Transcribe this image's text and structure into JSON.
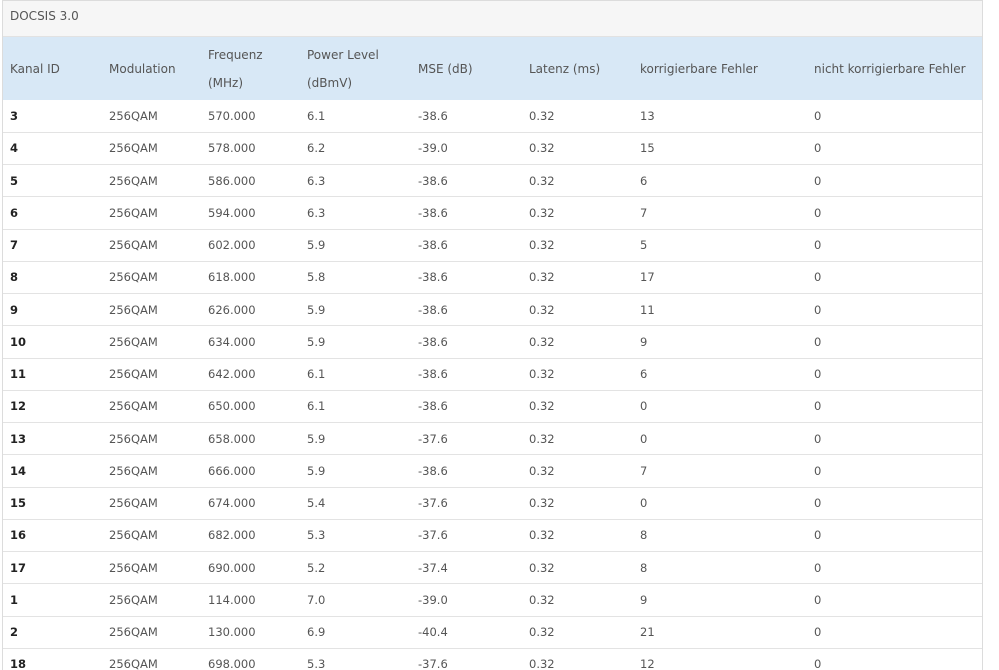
{
  "panel": {
    "title": "DOCSIS 3.0"
  },
  "table": {
    "headers": [
      [
        "Kanal ID"
      ],
      [
        "Modulation"
      ],
      [
        "Frequenz (MHz)"
      ],
      [
        "Power Level",
        "(dBmV)"
      ],
      [
        "MSE (dB)"
      ],
      [
        "Latenz (ms)"
      ],
      [
        "korrigierbare Fehler"
      ],
      [
        "nicht korrigierbare Fehler"
      ]
    ],
    "rows": [
      [
        "3",
        "256QAM",
        "570.000",
        "6.1",
        "-38.6",
        "0.32",
        "13",
        "0"
      ],
      [
        "4",
        "256QAM",
        "578.000",
        "6.2",
        "-39.0",
        "0.32",
        "15",
        "0"
      ],
      [
        "5",
        "256QAM",
        "586.000",
        "6.3",
        "-38.6",
        "0.32",
        "6",
        "0"
      ],
      [
        "6",
        "256QAM",
        "594.000",
        "6.3",
        "-38.6",
        "0.32",
        "7",
        "0"
      ],
      [
        "7",
        "256QAM",
        "602.000",
        "5.9",
        "-38.6",
        "0.32",
        "5",
        "0"
      ],
      [
        "8",
        "256QAM",
        "618.000",
        "5.8",
        "-38.6",
        "0.32",
        "17",
        "0"
      ],
      [
        "9",
        "256QAM",
        "626.000",
        "5.9",
        "-38.6",
        "0.32",
        "11",
        "0"
      ],
      [
        "10",
        "256QAM",
        "634.000",
        "5.9",
        "-38.6",
        "0.32",
        "9",
        "0"
      ],
      [
        "11",
        "256QAM",
        "642.000",
        "6.1",
        "-38.6",
        "0.32",
        "6",
        "0"
      ],
      [
        "12",
        "256QAM",
        "650.000",
        "6.1",
        "-38.6",
        "0.32",
        "0",
        "0"
      ],
      [
        "13",
        "256QAM",
        "658.000",
        "5.9",
        "-37.6",
        "0.32",
        "0",
        "0"
      ],
      [
        "14",
        "256QAM",
        "666.000",
        "5.9",
        "-38.6",
        "0.32",
        "7",
        "0"
      ],
      [
        "15",
        "256QAM",
        "674.000",
        "5.4",
        "-37.6",
        "0.32",
        "0",
        "0"
      ],
      [
        "16",
        "256QAM",
        "682.000",
        "5.3",
        "-37.6",
        "0.32",
        "8",
        "0"
      ],
      [
        "17",
        "256QAM",
        "690.000",
        "5.2",
        "-37.4",
        "0.32",
        "8",
        "0"
      ],
      [
        "1",
        "256QAM",
        "114.000",
        "7.0",
        "-39.0",
        "0.32",
        "9",
        "0"
      ],
      [
        "2",
        "256QAM",
        "130.000",
        "6.9",
        "-40.4",
        "0.32",
        "21",
        "0"
      ],
      [
        "18",
        "256QAM",
        "698.000",
        "5.3",
        "-37.6",
        "0.32",
        "12",
        "0"
      ]
    ]
  },
  "colors": {
    "header_bg": "#d8e8f6",
    "title_bg": "#f6f6f6"
  }
}
